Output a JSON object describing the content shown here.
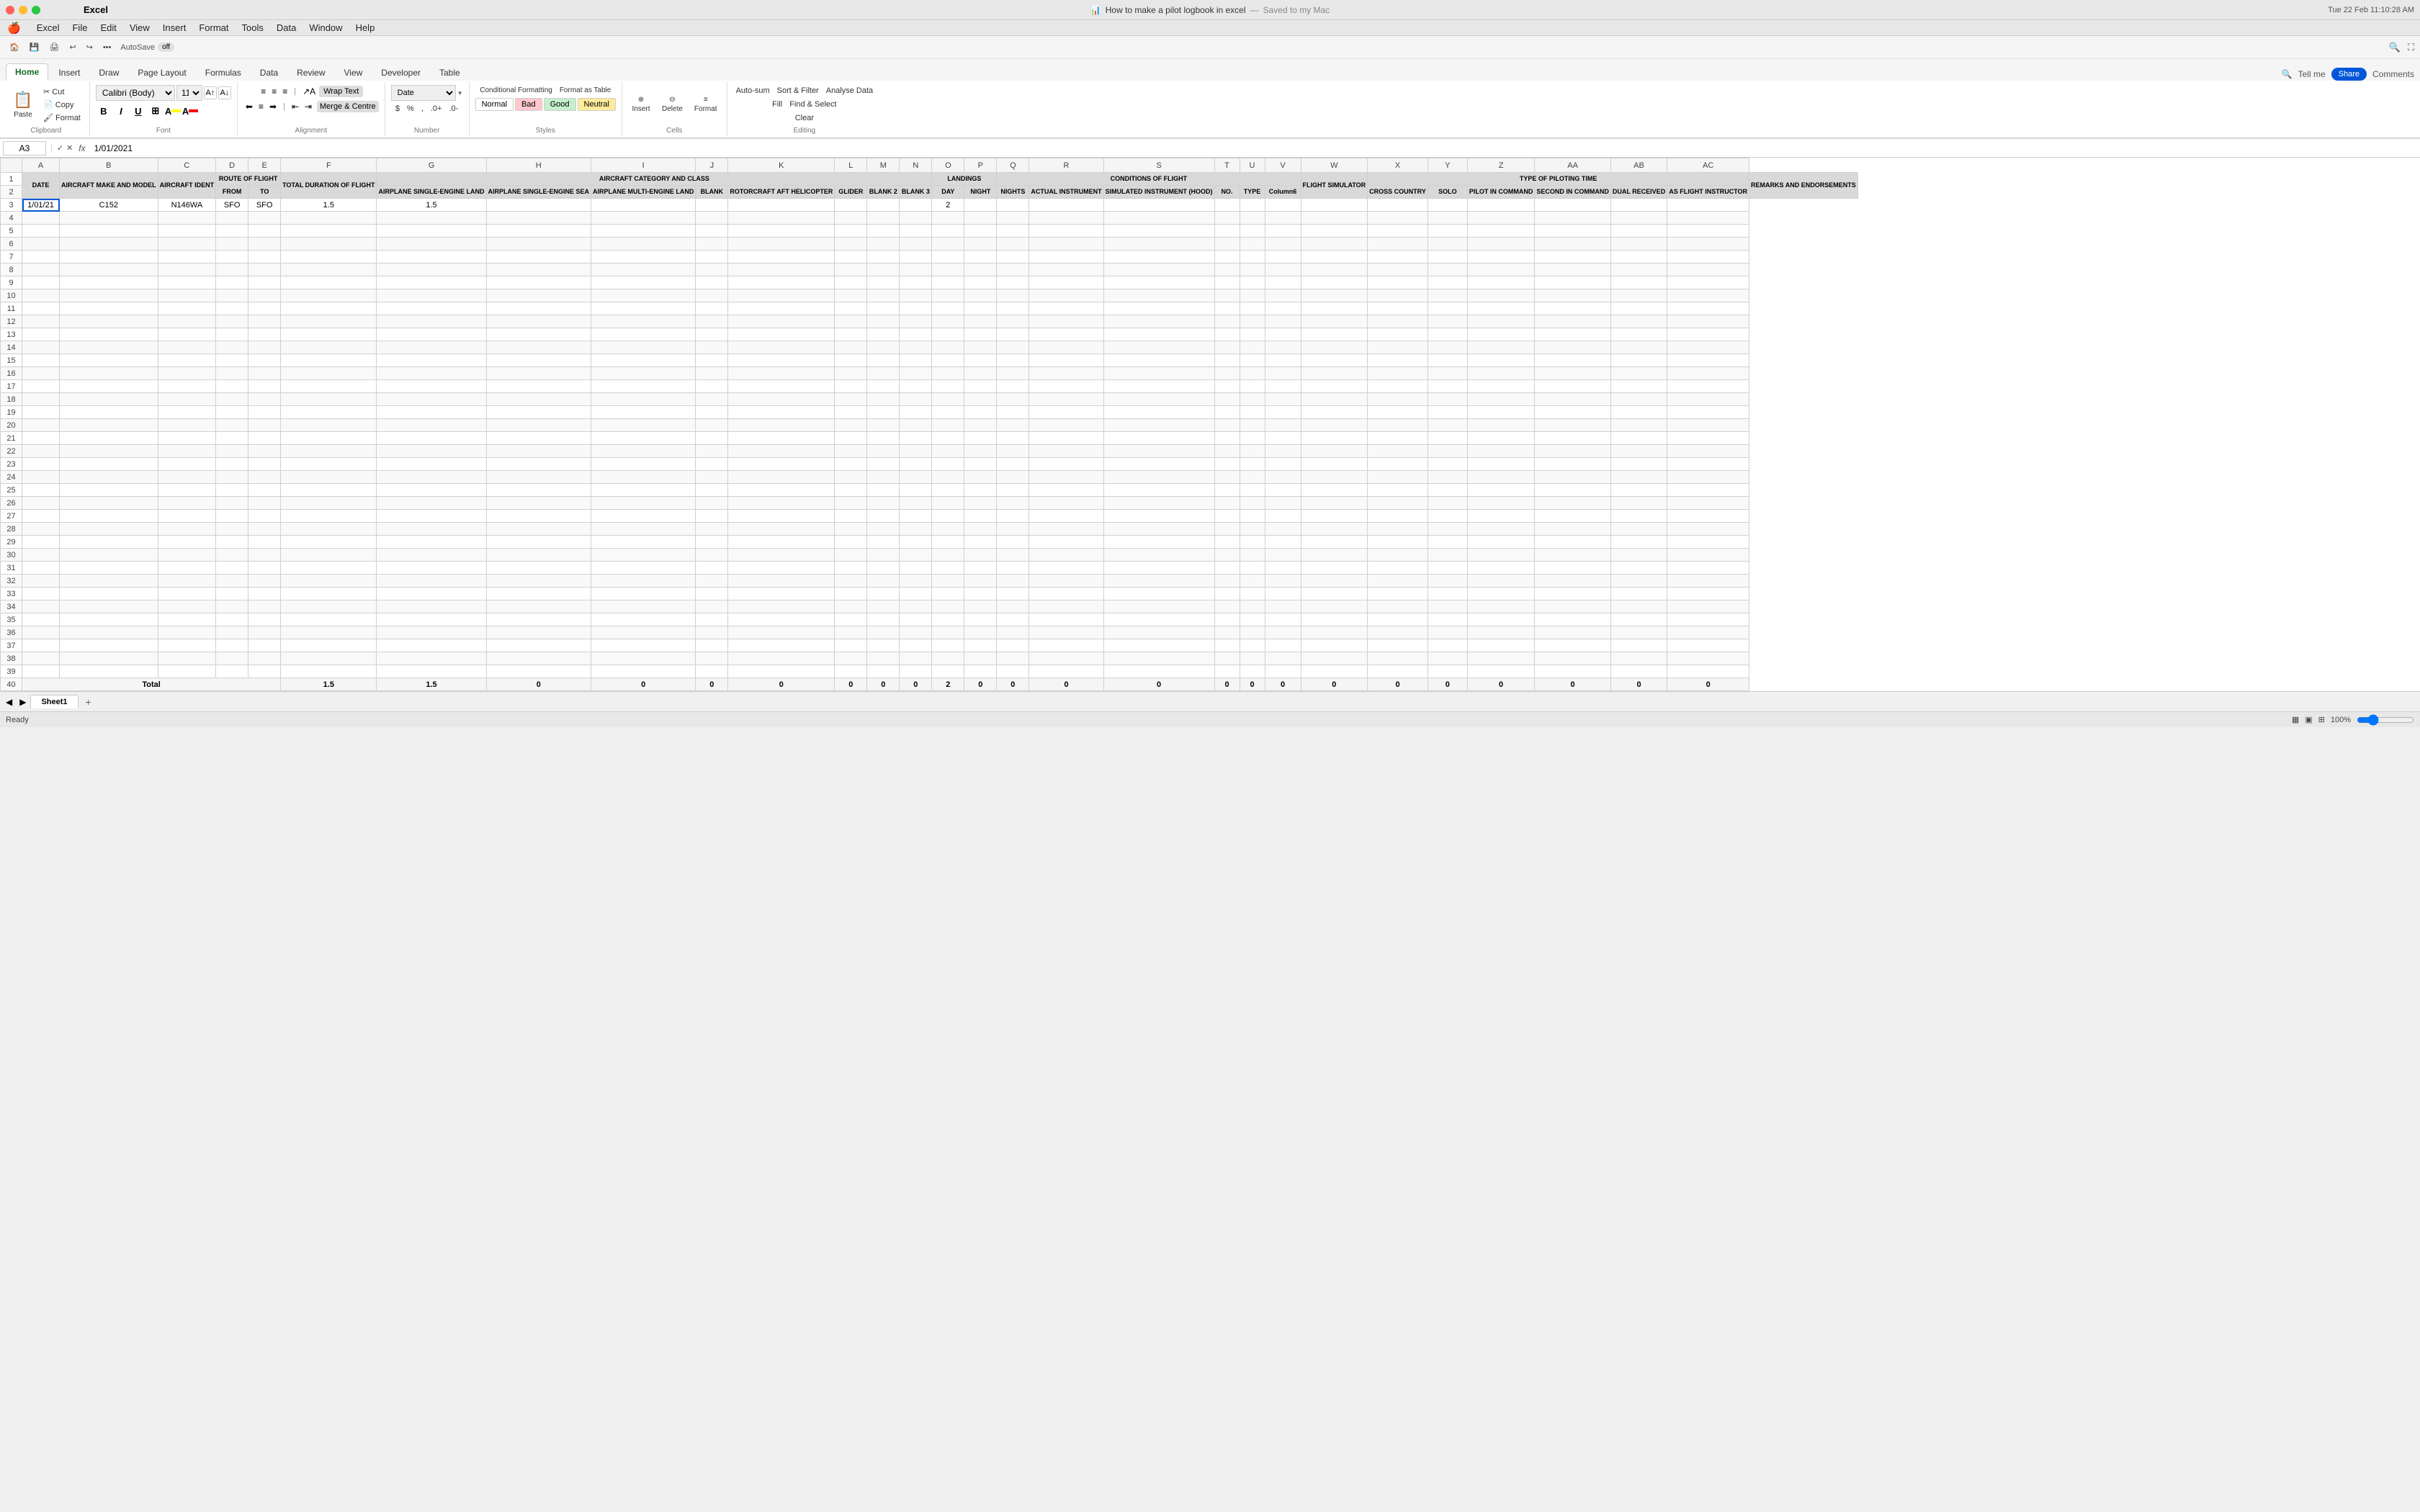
{
  "window": {
    "app": "Excel",
    "title": "How to make a pilot logbook in excel",
    "subtitle": "Saved to my Mac",
    "time": "Tue 22 Feb  11:10:28 AM"
  },
  "menu": {
    "apple": "🍎",
    "items": [
      "Excel",
      "File",
      "Edit",
      "View",
      "Insert",
      "Format",
      "Tools",
      "Data",
      "Window",
      "Help"
    ]
  },
  "quick_toolbar": {
    "autosave_label": "AutoSave",
    "autosave_state": "off",
    "undo_label": "↩",
    "redo_label": "↪"
  },
  "ribbon_tabs": {
    "tabs": [
      "Home",
      "Insert",
      "Draw",
      "Page Layout",
      "Formulas",
      "Data",
      "Review",
      "View",
      "Developer",
      "Table"
    ],
    "active": "Home",
    "tell_me": "Tell me",
    "share": "Share",
    "comments": "Comments"
  },
  "ribbon": {
    "clipboard": {
      "label": "Clipboard",
      "paste_label": "Paste",
      "cut_label": "Cut",
      "copy_label": "Copy",
      "format_painter_label": "Format"
    },
    "font": {
      "label": "Font",
      "font_name": "Calibri (Body)",
      "font_size": "11",
      "bold": "B",
      "italic": "I",
      "underline": "U",
      "border_label": "⊞",
      "fill_label": "A",
      "font_color_label": "A"
    },
    "alignment": {
      "label": "Alignment",
      "wrap_text": "Wrap Text",
      "merge_center": "Merge & Centre",
      "align_left": "≡",
      "align_center": "≡",
      "align_right": "≡",
      "indent_decrease": "⇤",
      "indent_increase": "⇥"
    },
    "number": {
      "label": "Number",
      "format": "Date",
      "currency": "$",
      "percent": "%",
      "comma": ","
    },
    "styles": {
      "label": "Styles",
      "conditional_formatting": "Conditional Formatting",
      "format_as_table": "Format as Table",
      "normal": "Normal",
      "bad": "Bad",
      "good": "Good",
      "neutral": "Neutral"
    },
    "cells": {
      "label": "Cells",
      "insert": "Insert",
      "delete": "Delete",
      "format": "Format"
    },
    "editing": {
      "label": "Editing",
      "autosum": "Auto-sum",
      "fill": "Fill",
      "clear": "Clear",
      "sort_filter": "Sort & Filter",
      "find_select": "Find & Select",
      "analyse_data": "Analyse Data"
    }
  },
  "formula_bar": {
    "cell_ref": "A3",
    "formula": "1/01/2021"
  },
  "headers": {
    "row1": [
      "DATE",
      "AIRCRAFT MAKE AND MODEL",
      "AIRCRAFT IDENT",
      "ROUTE OF FLIGHT",
      "",
      "TOTAL DURATION OF FLIGHT",
      "AIRCRAFT CATEGORY AND CLASS",
      "",
      "",
      "",
      "",
      "",
      "",
      "",
      "",
      "LANDINGS",
      "",
      "CONDITIONS OF FLIGHT",
      "",
      "",
      "",
      "",
      "FLIGHT SIMULATOR",
      "TYPE OF PILOTING TIME",
      "",
      "",
      "",
      "",
      "",
      "REMARKS AND ENDORSEMENTS"
    ],
    "route_sub": [
      "FROM",
      "TO"
    ],
    "aircraft_sub": [
      "AIRPLANE SINGLE-ENGINE LAND",
      "AIRPLANE SINGLE-ENGINE SEA",
      "AIRPLANE MULTI-ENGINE LAND",
      "BLANK",
      "ROTORCRAFT AFT HELICOPTER",
      "GLIDER",
      "BLANK 2",
      "BLANK 3"
    ],
    "landings_sub": [
      "DAY",
      "NIGHT"
    ],
    "conditions_sub": [
      "NIGHTS",
      "ACTUAL INSTRUMENT",
      "SIMULATED INSTRUMENT (HOOD)",
      "NO.",
      "TYPE",
      "Column6"
    ],
    "piloting_sub": [
      "CROSS COUNTRY",
      "SOLO",
      "PILOT IN COMMAND",
      "SECOND IN COMMAND",
      "DUAL RECEIVED",
      "AS FLIGHT INSTRUCTOR"
    ]
  },
  "data": {
    "rows": [
      {
        "row": 3,
        "date": "1/01/21",
        "aircraft_make": "C152",
        "aircraft_ident": "N146WA",
        "from": "SFO",
        "to": "SFO",
        "total_duration": "1.5",
        "se_land": "1.5",
        "day": "2"
      }
    ],
    "totals": {
      "row": 40,
      "label": "Total",
      "total_duration": "1.5",
      "se_land": "1.5",
      "se_sea": "0",
      "me_land": "0",
      "blank": "0",
      "rotorcraft": "0",
      "glider": "0",
      "blank2": "0",
      "blank3": "0",
      "day": "2",
      "night": "0",
      "nights": "0",
      "actual_inst": "0",
      "sim_inst": "0",
      "no": "0",
      "type_col": "0",
      "col6": "0",
      "cross_country": "0",
      "solo": "0",
      "pic": "0",
      "sic": "0",
      "dual_received": "0",
      "as_fi": "0",
      "last": "0"
    }
  },
  "sheet_tabs": {
    "sheets": [
      "Sheet1"
    ],
    "active": "Sheet1"
  },
  "status_bar": {
    "ready": "Ready",
    "zoom": "100%"
  }
}
